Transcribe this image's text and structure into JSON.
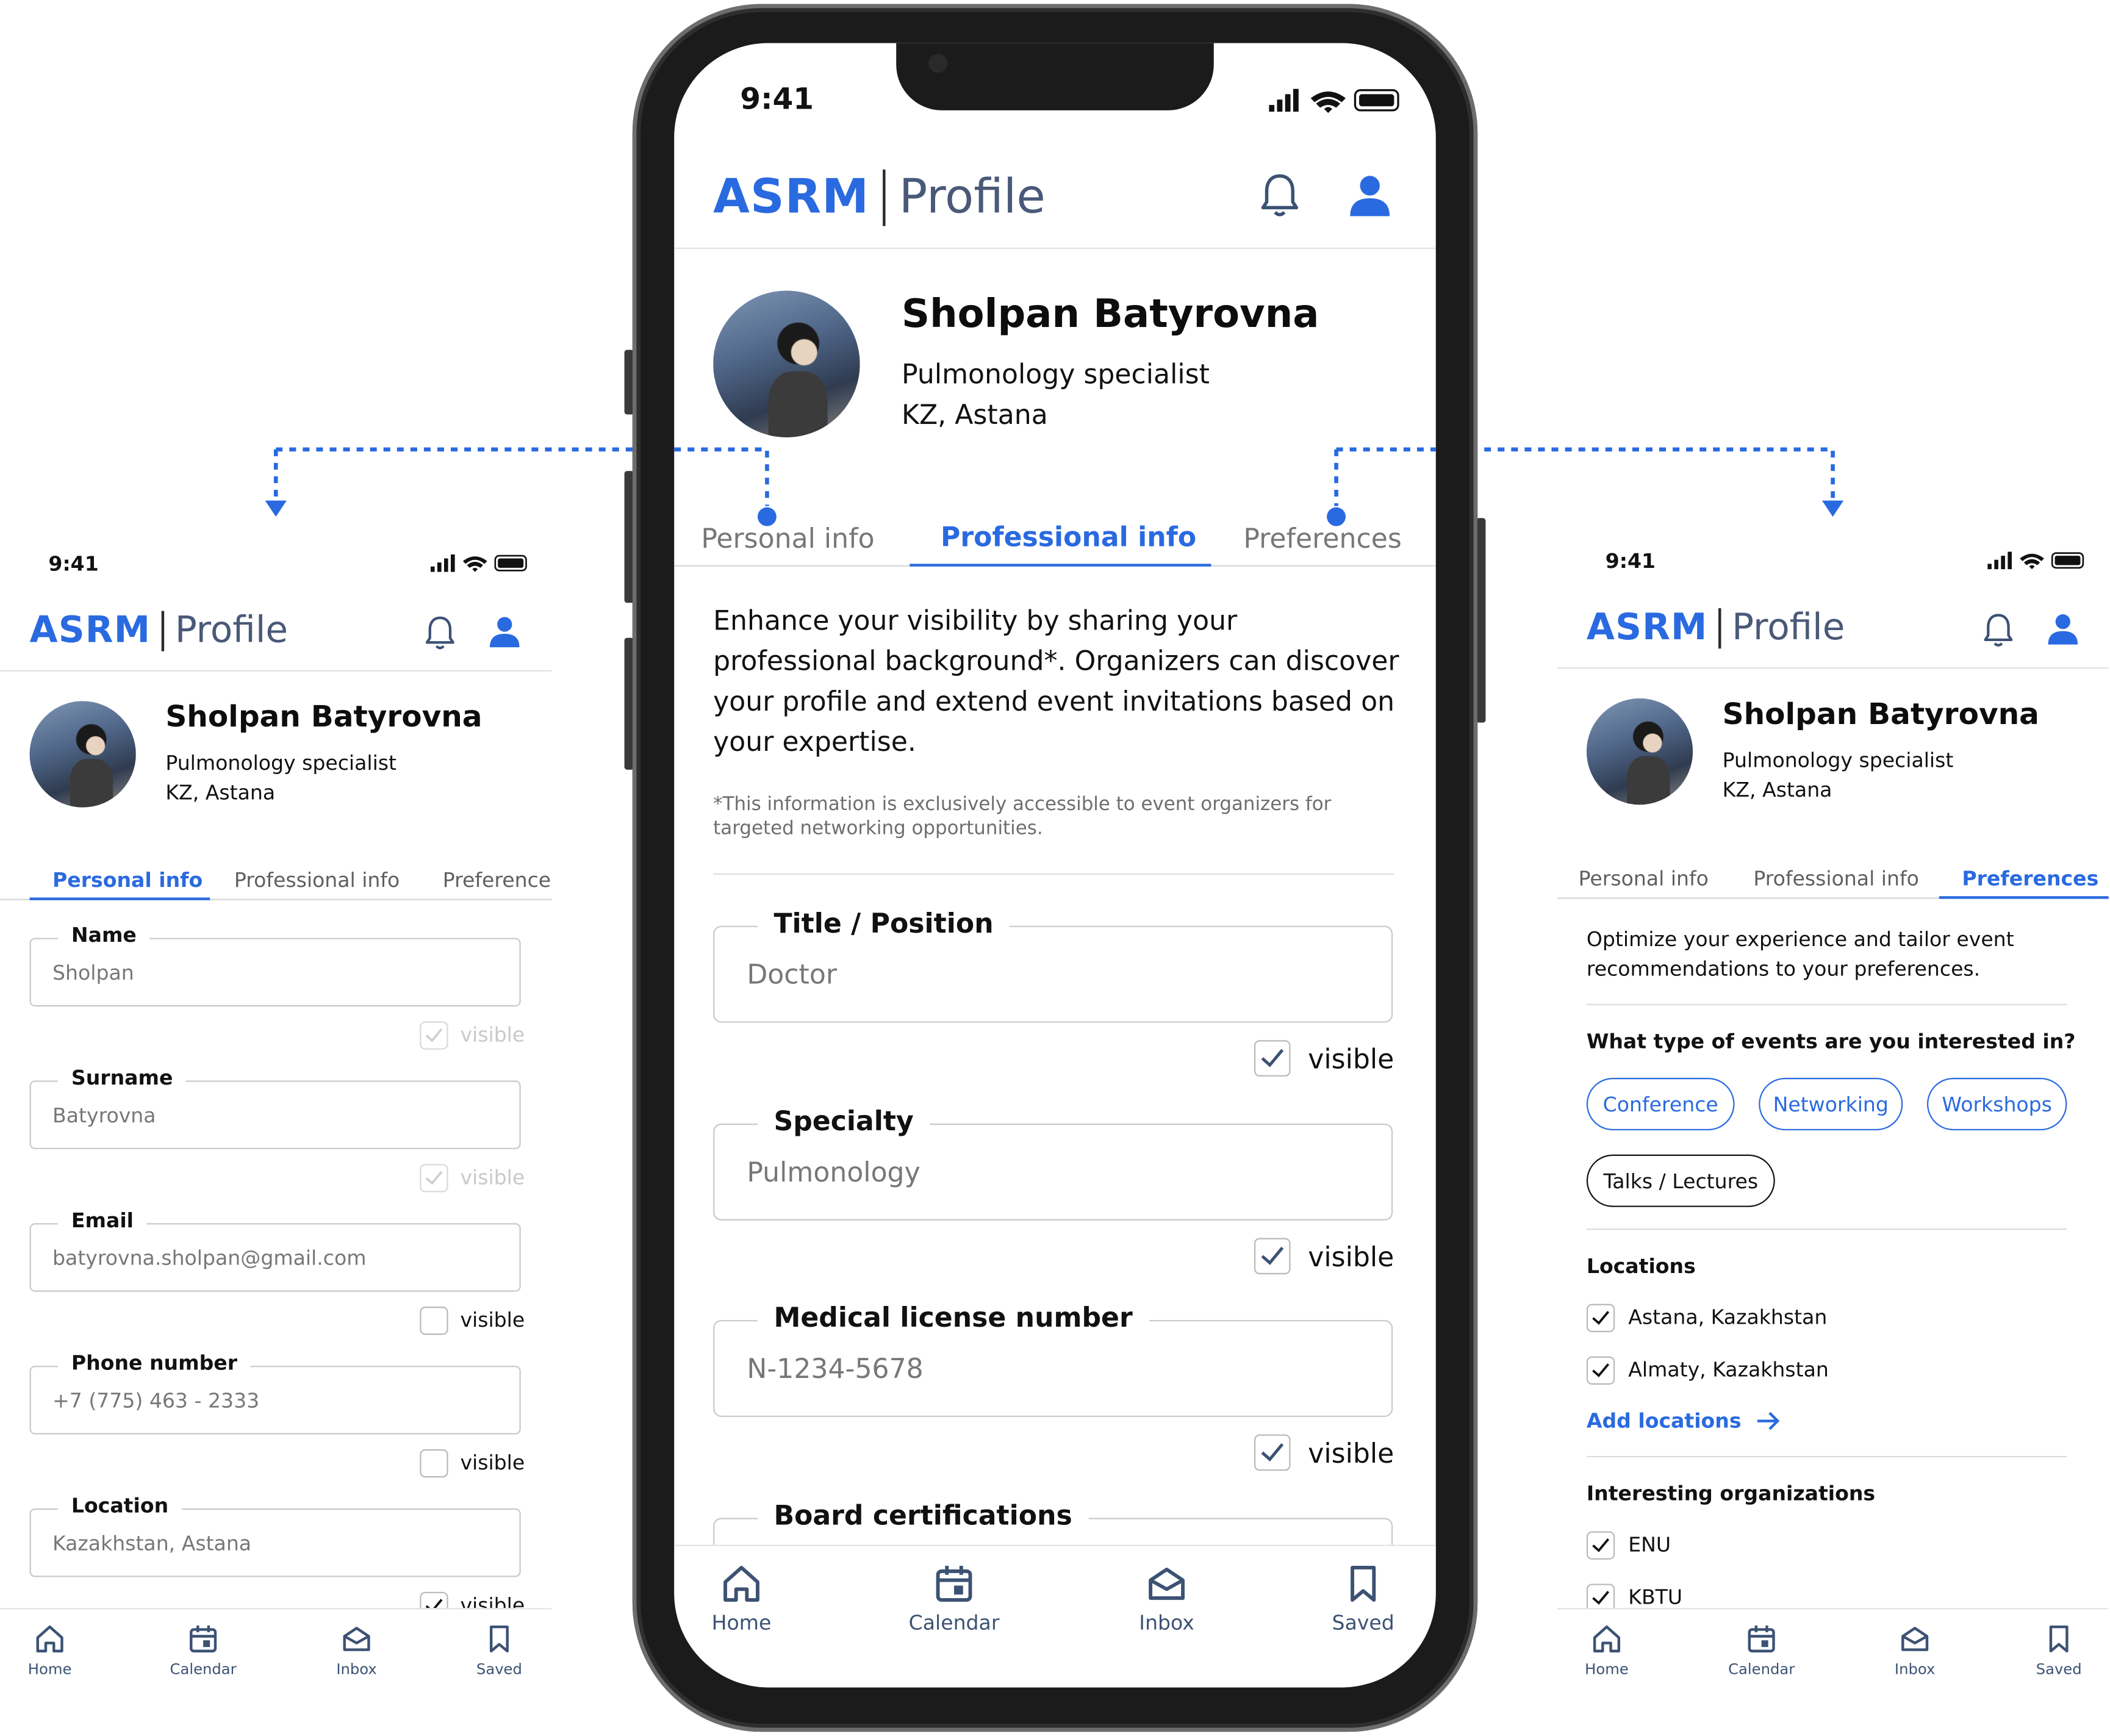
{
  "status": {
    "time": "9:41"
  },
  "app": {
    "brand": "ASRM",
    "section": "Profile"
  },
  "profile": {
    "name": "Sholpan Batyrovna",
    "role": "Pulmonology specialist",
    "location": "KZ, Astana"
  },
  "tabs": {
    "personal": "Personal info",
    "professional": "Professional info",
    "preferences": "Preferences",
    "preferences_cut": "Preference:"
  },
  "nav": {
    "home": "Home",
    "calendar": "Calendar",
    "inbox": "Inbox",
    "saved": "Saved"
  },
  "personal": {
    "visible_label": "visible",
    "visible_cut": "visible",
    "fields": [
      {
        "label": "Name",
        "value": "Sholpan"
      },
      {
        "label": "Surname",
        "value": "Batyrovna"
      },
      {
        "label": "Email",
        "value": "batyrovna.sholpan@gmail.com"
      },
      {
        "label": "Phone number",
        "value": "+7 (775) 463 - 2333"
      },
      {
        "label": "Location",
        "value": "Kazakhstan, Astana"
      }
    ]
  },
  "professional": {
    "intro": "Enhance your visibility by sharing your professional background*. Organizers can discover your profile and extend event invitations based on your expertise.",
    "note": "*This information is exclusively accessible to event organizers for targeted networking opportunities.",
    "visible_label": "visible",
    "fields": [
      {
        "label": "Title / Position",
        "value": "Doctor"
      },
      {
        "label": "Specialty",
        "value": "Pulmonology"
      },
      {
        "label": "Medical license number",
        "value": "N-1234-5678"
      },
      {
        "label": "Board certifications",
        "value": ""
      }
    ]
  },
  "preferences": {
    "intro": "Optimize your experience and tailor event recommendations to your preferences.",
    "events_question": "What type of events are you interested in?",
    "event_types": [
      "Conference",
      "Networking",
      "Workshops",
      "Talks / Lectures"
    ],
    "locations_title": "Locations",
    "locations": [
      "Astana, Kazakhstan",
      "Almaty, Kazakhstan"
    ],
    "add_locations": "Add locations",
    "orgs_title": "Interesting organizations",
    "orgs": [
      "ENU",
      "KBTU"
    ]
  },
  "colors": {
    "accent": "#2a6ae0",
    "nav": "#3c5274",
    "text": "#111111"
  }
}
